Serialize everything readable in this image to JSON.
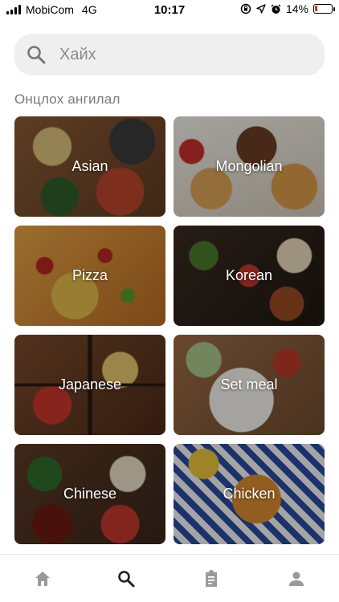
{
  "status_bar": {
    "carrier": "MobiCom",
    "network": "4G",
    "time": "10:17",
    "battery_percent": "14%",
    "battery_level": 0.14,
    "icons": [
      "signal-bars-icon",
      "lock-rotation-icon",
      "location-arrow-icon",
      "alarm-icon",
      "battery-icon"
    ]
  },
  "search": {
    "placeholder": "Хайх",
    "value": ""
  },
  "section": {
    "title": "Онцлох ангилал"
  },
  "categories": [
    {
      "label": "Asian"
    },
    {
      "label": "Mongolian"
    },
    {
      "label": "Pizza"
    },
    {
      "label": "Korean"
    },
    {
      "label": "Japanese"
    },
    {
      "label": "Set meal"
    },
    {
      "label": "Chinese"
    },
    {
      "label": "Chicken"
    }
  ],
  "bottom_nav": {
    "items": [
      {
        "icon": "home-icon",
        "active": false
      },
      {
        "icon": "search-icon",
        "active": true
      },
      {
        "icon": "clipboard-icon",
        "active": false
      },
      {
        "icon": "person-icon",
        "active": false
      }
    ]
  },
  "colors": {
    "active_nav": "#222222",
    "inactive_nav": "#9a9a9a",
    "battery_low": "#e0302a",
    "search_bg": "#efefef"
  }
}
